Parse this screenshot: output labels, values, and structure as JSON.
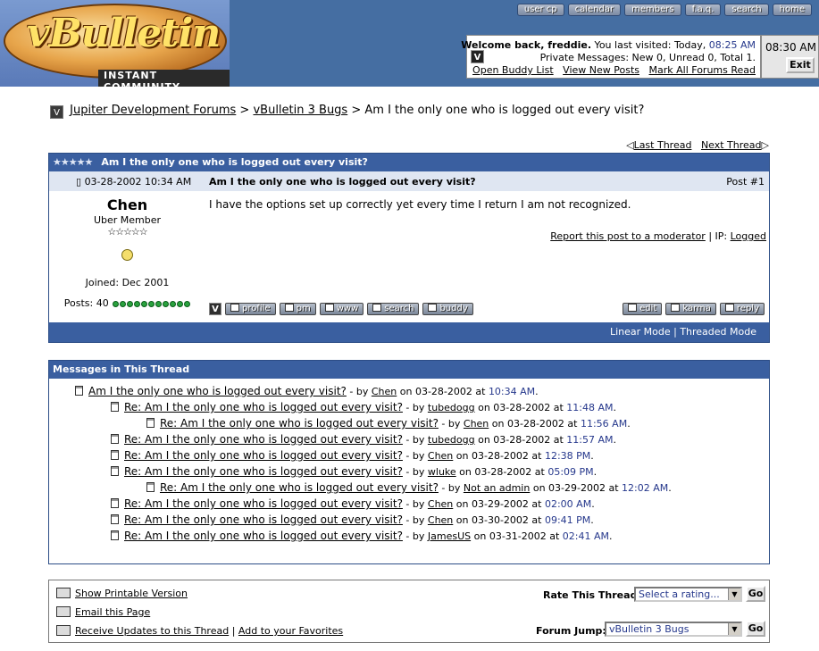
{
  "header": {
    "logo_word": "vBulletin",
    "logo_tag": "INSTANT COMMUNITY",
    "nav": [
      "user cp",
      "calendar",
      "members",
      "f.a.q.",
      "search",
      "home"
    ],
    "welcome_prefix": "Welcome back, freddie.",
    "welcome_visit": " You last visited: Today, ",
    "welcome_time": "08:25 AM",
    "pm_status": "Private Messages: New 0, Unread 0, Total 1.",
    "links": [
      "Open Buddy List",
      "View New Posts",
      "Mark All Forums Read"
    ],
    "clock": "08:30 AM",
    "exit_label": "Exit"
  },
  "breadcrumb": {
    "forum": "Jupiter Development Forums",
    "sep": " > ",
    "subforum": "vBulletin 3 Bugs",
    "thread": "Am I the only one who is logged out every visit?"
  },
  "thread_nav": {
    "prev": "Last Thread",
    "next": "Next Thread"
  },
  "post": {
    "header_stars": "★★★★★",
    "header_title": "Am I the only one who is logged out every visit?",
    "date": "03-28-2002 10:34 AM",
    "title": "Am I the only one who is logged out every visit?",
    "number": "Post #1",
    "author": "Chen",
    "author_title": "Uber Member",
    "author_stars": "☆☆☆☆☆",
    "joined": "Joined: Dec 2001",
    "posts": "Posts: 40",
    "body": "I have the options set up correctly yet every time I return I am not recognized.",
    "report": "Report this post to a moderator",
    "ip_label": " | IP: ",
    "ip_value": "Logged",
    "left_buttons": [
      "profile",
      "pm",
      "www",
      "search",
      "buddy"
    ],
    "right_buttons": [
      "edit",
      "karma",
      "reply"
    ],
    "mode_linear": "Linear Mode",
    "mode_sep": " | ",
    "mode_threaded": "Threaded Mode"
  },
  "thread_list": {
    "title": "Messages in This Thread",
    "items": [
      {
        "subject": "Am I the only one who is logged out every visit?",
        "by": " - by ",
        "author": "Chen",
        "on": " on 03-28-2002 at ",
        "time": "10:34 AM",
        "end": "."
      },
      {
        "subject": "Re: Am I the only one who is logged out every visit?",
        "by": " - by ",
        "author": "tubedogg",
        "on": " on 03-28-2002 at ",
        "time": "11:48 AM",
        "end": "."
      },
      {
        "subject": "Re: Am I the only one who is logged out every visit?",
        "by": " - by ",
        "author": "Chen",
        "on": " on 03-28-2002 at ",
        "time": "11:56 AM",
        "end": "."
      },
      {
        "subject": "Re: Am I the only one who is logged out every visit?",
        "by": " - by ",
        "author": "tubedogg",
        "on": " on 03-28-2002 at ",
        "time": "11:57 AM",
        "end": "."
      },
      {
        "subject": "Re: Am I the only one who is logged out every visit?",
        "by": " - by ",
        "author": "Chen",
        "on": " on 03-28-2002 at ",
        "time": "12:38 PM",
        "end": "."
      },
      {
        "subject": "Re: Am I the only one who is logged out every visit?",
        "by": " - by ",
        "author": "wluke",
        "on": " on 03-28-2002 at ",
        "time": "05:09 PM",
        "end": "."
      },
      {
        "subject": "Re: Am I the only one who is logged out every visit?",
        "by": " - by ",
        "author": "Not an admin",
        "on": " on 03-29-2002 at ",
        "time": "12:02 AM",
        "end": "."
      },
      {
        "subject": "Re: Am I the only one who is logged out every visit?",
        "by": " - by ",
        "author": "Chen",
        "on": " on 03-29-2002 at ",
        "time": "02:00 AM",
        "end": "."
      },
      {
        "subject": "Re: Am I the only one who is logged out every visit?",
        "by": " - by ",
        "author": "Chen",
        "on": " on 03-30-2002 at ",
        "time": "09:41 PM",
        "end": "."
      },
      {
        "subject": "Re: Am I the only one who is logged out every visit?",
        "by": " - by ",
        "author": "JamesUS",
        "on": " on 03-31-2002 at ",
        "time": "02:41 AM",
        "end": "."
      }
    ]
  },
  "bottom": {
    "printable": "Show Printable Version",
    "email": "Email this Page",
    "updates": "Receive Updates to this Thread",
    "updates_sep": " | ",
    "favorites": "Add to your Favorites",
    "rate_label": "Rate This Thread:",
    "rate_value": "Select a rating...",
    "jump_label": "Forum Jump:",
    "jump_value": "vBulletin 3 Bugs",
    "go_label": "Go"
  }
}
